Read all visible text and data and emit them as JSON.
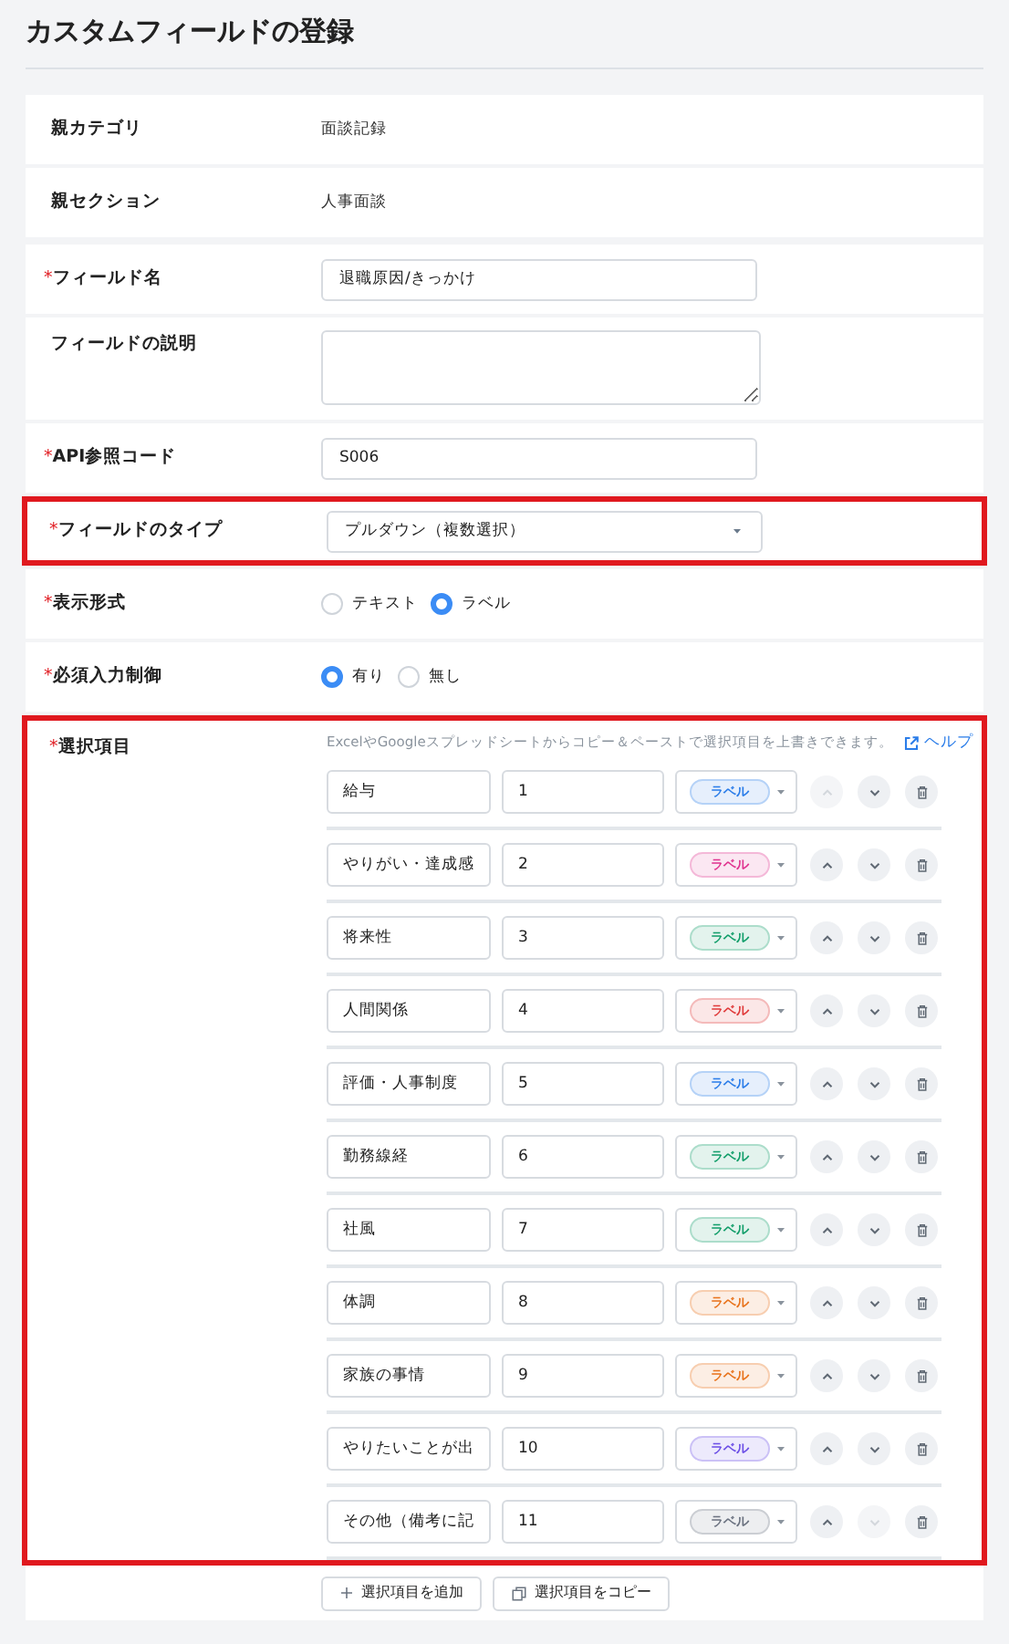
{
  "title": "カスタムフィールドの登録",
  "rows": [
    {
      "kind": "text",
      "label": "親カテゴリ",
      "highlighted": false,
      "value": "面談記録"
    },
    {
      "kind": "text",
      "label": "親セクション",
      "highlighted": false,
      "value": "人事面談"
    },
    {
      "kind": "input",
      "label": "フィールド名",
      "marker": "*",
      "highlighted": false,
      "value": "退職原因/きっかけ"
    },
    {
      "kind": "textarea",
      "label": "フィールドの説明",
      "highlighted": false
    },
    {
      "kind": "input",
      "label": "API参照コード",
      "marker": "*",
      "highlighted": false,
      "value": "S006"
    },
    {
      "kind": "select",
      "label": "フィールドのタイプ",
      "marker": "*",
      "highlighted": true,
      "value": "プルダウン（複数選択）"
    },
    {
      "kind": "radio",
      "label": "表示形式",
      "marker": "*",
      "highlighted": false,
      "options": [
        {
          "label": "テキスト",
          "selected": false
        },
        {
          "label": "ラベル",
          "selected": true
        }
      ]
    },
    {
      "kind": "radio",
      "label": "必須入力制御",
      "marker": "*",
      "highlighted": false,
      "options": [
        {
          "label": "有り",
          "selected": true
        },
        {
          "label": "無し",
          "selected": false
        }
      ]
    },
    {
      "kind": "options",
      "label": "選択項目",
      "marker": "*",
      "highlighted": true,
      "hint": "ExcelやGoogleスプレッドシートからコピー＆ペーストで選択項目を上書きできます。",
      "help_link": "ヘルプ",
      "items": [
        {
          "name": "給与",
          "code": "1",
          "tag": "ラベル",
          "color": "#2b7de9",
          "up_disabled": true,
          "down_disabled": false
        },
        {
          "name": "やりがい・達成感",
          "code": "2",
          "tag": "ラベル",
          "color": "#e0338f",
          "up_disabled": false,
          "down_disabled": false
        },
        {
          "name": "将来性",
          "code": "3",
          "tag": "ラベル",
          "color": "#129e6a",
          "up_disabled": false,
          "down_disabled": false
        },
        {
          "name": "人間関係",
          "code": "4",
          "tag": "ラベル",
          "color": "#e03a3a",
          "up_disabled": false,
          "down_disabled": false
        },
        {
          "name": "評価・人事制度",
          "code": "5",
          "tag": "ラベル",
          "color": "#2b7de9",
          "up_disabled": false,
          "down_disabled": false
        },
        {
          "name": "勤務線経",
          "code": "6",
          "tag": "ラベル",
          "color": "#129e6a",
          "up_disabled": false,
          "down_disabled": false
        },
        {
          "name": "社風",
          "code": "7",
          "tag": "ラベル",
          "color": "#129e6a",
          "up_disabled": false,
          "down_disabled": false
        },
        {
          "name": "体調",
          "code": "8",
          "tag": "ラベル",
          "color": "#e8731c",
          "up_disabled": false,
          "down_disabled": false
        },
        {
          "name": "家族の事情",
          "code": "9",
          "tag": "ラベル",
          "color": "#e8731c",
          "up_disabled": false,
          "down_disabled": false
        },
        {
          "name": "やりたいことが出",
          "code": "10",
          "tag": "ラベル",
          "color": "#6b4ee6",
          "up_disabled": false,
          "down_disabled": false
        },
        {
          "name": "その他（備考に記",
          "code": "11",
          "tag": "ラベル",
          "color": "#6b7280",
          "up_disabled": false,
          "down_disabled": true
        }
      ],
      "buttons": [
        {
          "kind": "add",
          "label": "選択項目を追加"
        },
        {
          "kind": "copy",
          "label": "選択項目をコピー"
        }
      ]
    }
  ]
}
